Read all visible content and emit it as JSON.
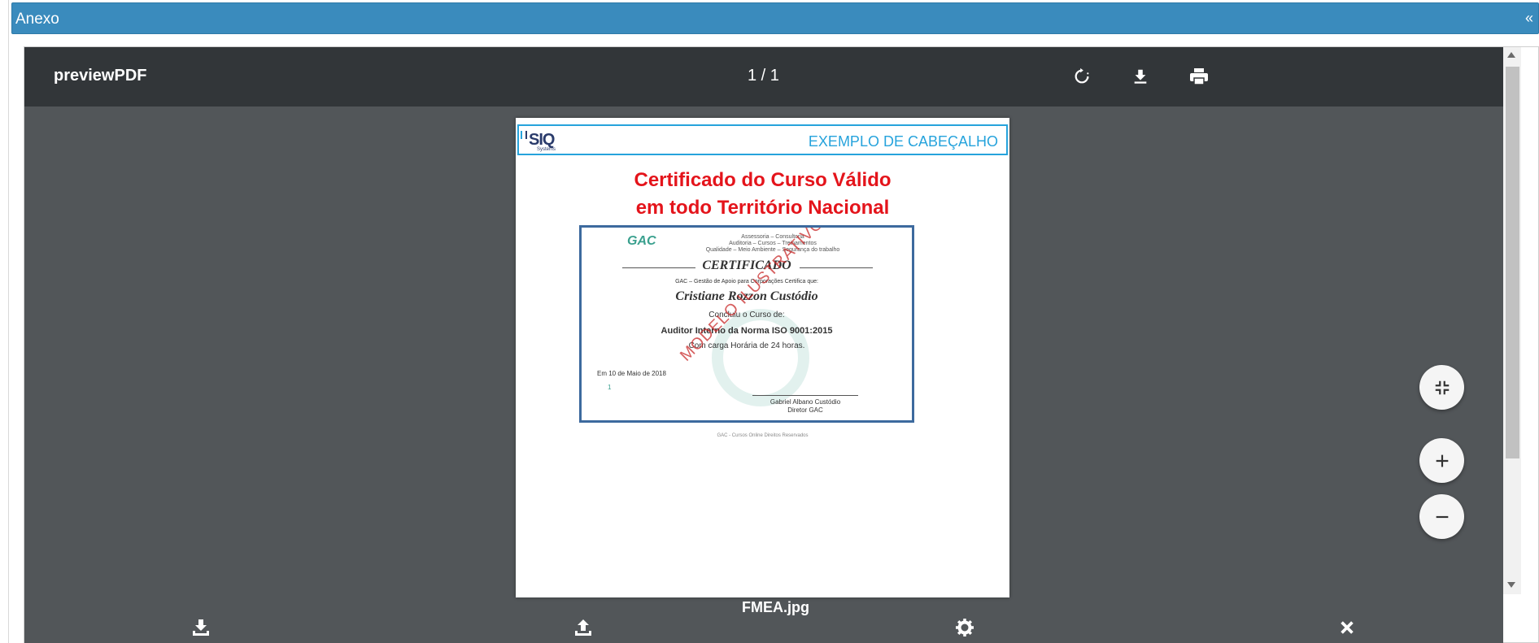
{
  "panel": {
    "title": "Anexo",
    "collapse_label": "«"
  },
  "toolbar": {
    "doc_name": "previewPDF",
    "page_counter": "1 / 1",
    "icons": [
      "rotate-icon",
      "download-icon",
      "print-icon"
    ]
  },
  "page": {
    "header_logo": "SIQ",
    "header_logo_sub": "Systems",
    "header_text": "EXEMPLO DE CABEÇALHO",
    "title_line1": "Certificado do Curso Válido",
    "title_line2": "em todo Território Nacional",
    "footer": "GAC - Cursos Online Direitos Reservados"
  },
  "certificate": {
    "logo": "GAC",
    "services_line1": "Assessoria – Consultoria",
    "services_line2": "Auditoria – Cursos – Treinamentos",
    "services_line3": "Qualidade – Meio Ambiente – Segurança do trabalho",
    "heading": "CERTIFICADO",
    "certifies": "GAC – Gestão de Apoio para Corporações Certifica que:",
    "name": "Cristiane Rozzon Custódio",
    "concluded": "Concluiu o Curso de:",
    "course": "Auditor Interno da Norma ISO 9001:2015",
    "hours": "Com carga Horária de 24 horas.",
    "watermark": "MODELO ILUSTRATIVO",
    "date": "Em 10 de Maio de 2018",
    "signer_name": "Gabriel Albano Custódio",
    "signer_role": "Diretor GAC",
    "mark": "1"
  },
  "controls": {
    "fit_icon": "compress-icon",
    "zoom_in_icon": "plus-icon",
    "zoom_out_icon": "minus-icon"
  },
  "file": {
    "name": "FMEA.jpg",
    "actions": [
      "download-icon",
      "upload-icon",
      "gear-icon",
      "close-icon"
    ]
  },
  "colors": {
    "header_blue": "#3a8bbd",
    "toolbar_dark": "#323639",
    "viewer_gray": "#525659",
    "title_red": "#e4141b",
    "accent_cyan": "#26a3dc"
  }
}
